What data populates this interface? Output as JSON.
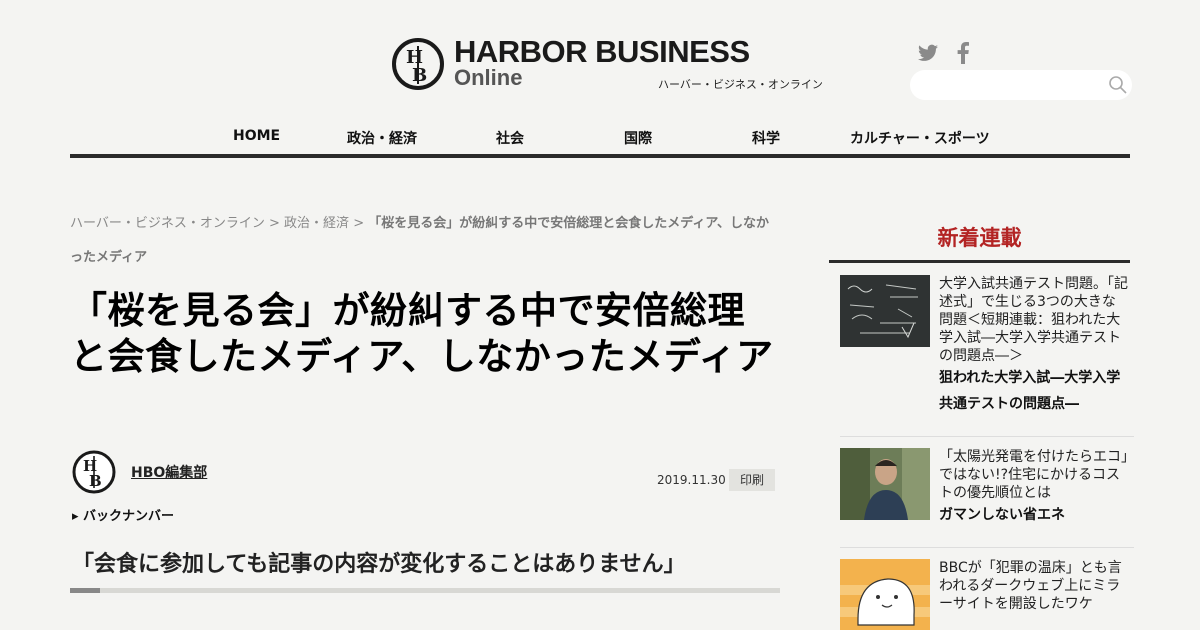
{
  "header": {
    "logo_title": "HARBOR BUSINESS",
    "logo_online": "Online",
    "logo_kana": "ハーバー・ビジネス・オンライン",
    "search_placeholder": ""
  },
  "nav": {
    "items": [
      "HOME",
      "政治・経済",
      "社会",
      "国際",
      "科学",
      "カルチャー・スポーツ"
    ]
  },
  "breadcrumb": {
    "home": "ハーバー・ビジネス・オンライン",
    "sep1": " > ",
    "category": "政治・経済",
    "sep2": " > ",
    "current": "「桜を見る会」が紛糾する中で安倍総理と会食したメディア、しなかったメディア"
  },
  "article": {
    "title": "「桜を見る会」が紛糾する中で安倍総理と会食したメディア、しなかったメディア",
    "author": "HBO編集部",
    "date": "2019.11.30",
    "print_label": "印刷",
    "backnumber_label": "▸ バックナンバー",
    "subtitle": "「会食に参加しても記事の内容が変化することはありません」"
  },
  "sidebar": {
    "heading": "新着連載",
    "items": [
      {
        "title": "大学入試共通テスト問題。「記述式」で生じる3つの大きな問題＜短期連載：狙われた大学入試―大学入学共通テストの問題点―＞",
        "series": "狙われた大学入試―大学入学共通テストの問題点―"
      },
      {
        "title": "「太陽光発電を付けたらエコ」ではない!?住宅にかけるコストの優先順位とは",
        "series": "ガマンしない省エネ"
      },
      {
        "title": "BBCが「犯罪の温床」とも言われるダークウェブ上にミラーサイトを開設したワケ",
        "series": ""
      }
    ]
  },
  "colors": {
    "accent": "#b32424",
    "rule": "#2b2b2b",
    "background": "#f4f4f2"
  }
}
